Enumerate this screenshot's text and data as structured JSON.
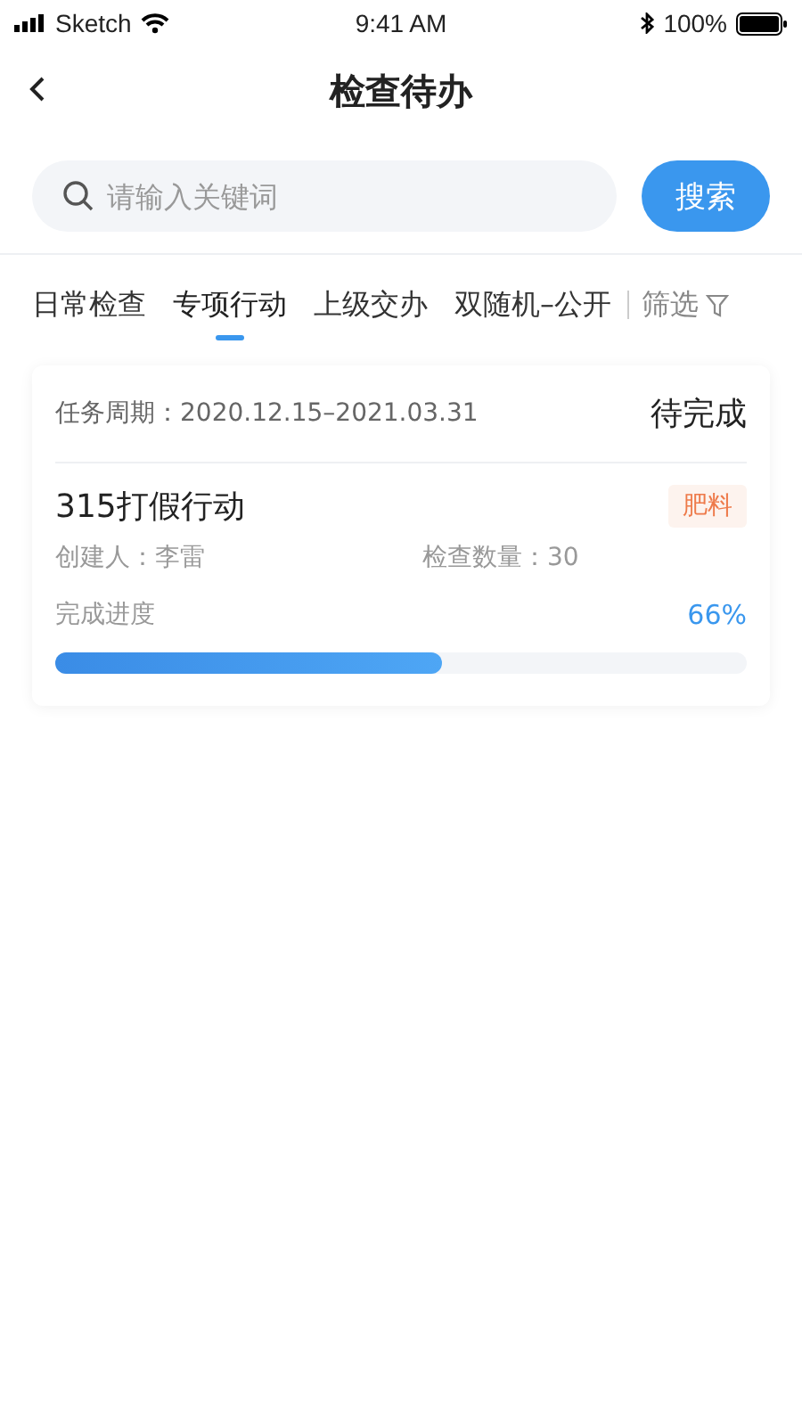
{
  "status_bar": {
    "carrier": "Sketch",
    "time": "9:41 AM",
    "battery": "100%"
  },
  "nav": {
    "title": "检查待办"
  },
  "search": {
    "placeholder": "请输入关键词",
    "button": "搜索"
  },
  "tabs": [
    {
      "label": "日常检查",
      "selected": false
    },
    {
      "label": "专项行动",
      "selected": true
    },
    {
      "label": "上级交办",
      "selected": false
    },
    {
      "label": "双随机–公开",
      "selected": false
    }
  ],
  "filter": {
    "label": "筛选"
  },
  "tasks": [
    {
      "period": "任务周期：2020.12.15–2021.03.31",
      "status": "待完成",
      "title": "315打假行动",
      "tag": "肥料",
      "creator": "创建人：李雷",
      "count": "检查数量：30",
      "progress_label": "完成进度",
      "progress_text": "66%",
      "level": 0.56
    }
  ]
}
